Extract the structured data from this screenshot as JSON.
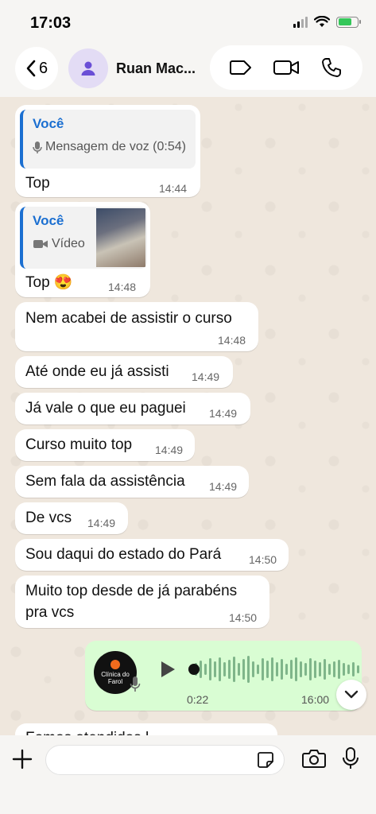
{
  "status_bar": {
    "time": "17:03"
  },
  "header": {
    "back_count": "6",
    "contact_name": "Ruan Mac..."
  },
  "messages": [
    {
      "quote_author": "Você",
      "quote_body": "Mensagem de voz (0:54)",
      "quote_icon": "mic-icon",
      "text": "Top",
      "time": "14:44"
    },
    {
      "quote_author": "Você",
      "quote_body": "Vídeo",
      "quote_icon": "video-icon",
      "text": "Top 😍",
      "time": "14:48"
    },
    {
      "text": "Nem acabei de assistir o curso",
      "time": "14:48"
    },
    {
      "text": "Até onde eu já assisti",
      "time": "14:49"
    },
    {
      "text": "Já vale o que eu paguei",
      "time": "14:49"
    },
    {
      "text": "Curso muito top",
      "time": "14:49"
    },
    {
      "text": "Sem fala da assistência",
      "time": "14:49"
    },
    {
      "text": "De vcs",
      "time": "14:49"
    },
    {
      "text": "Sou daqui do estado do Pará",
      "time": "14:50"
    },
    {
      "text_line1": "Muito top desde de já parabéns",
      "text_line2": "pra vcs",
      "time": "14:50"
    }
  ],
  "voice_message": {
    "avatar_text": "Clínica do Farol",
    "duration": "0:22",
    "time": "16:00",
    "progress": 0
  },
  "partial_message": {
    "text": "Fomos atendidos l..."
  },
  "input": {
    "placeholder": ""
  },
  "colors": {
    "outgoing_bubble": "#d9fdd3",
    "incoming_bubble": "#ffffff",
    "quote_accent": "#1b6fd1",
    "chat_background": "#efe7dd"
  }
}
